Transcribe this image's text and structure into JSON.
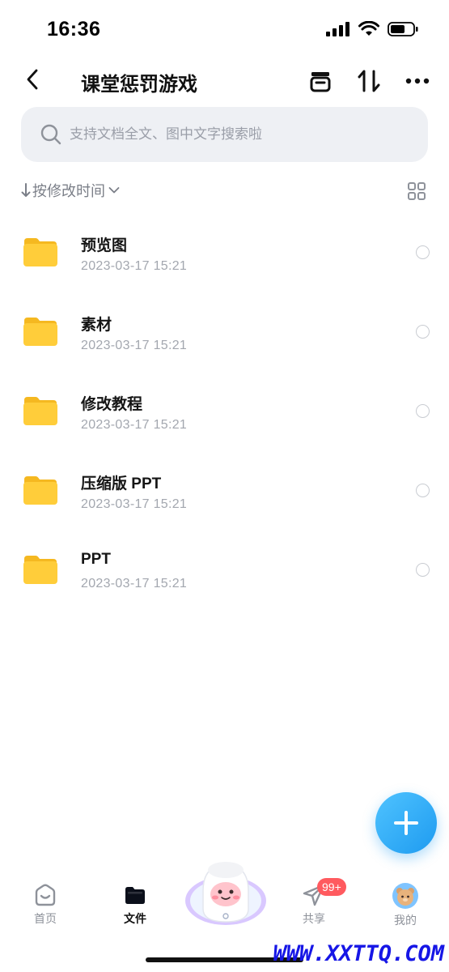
{
  "status_bar": {
    "time": "16:36"
  },
  "header": {
    "title": "课堂惩罚游戏"
  },
  "search": {
    "placeholder": "支持文档全文、图中文字搜索啦"
  },
  "sort": {
    "label": "按修改时间"
  },
  "files": [
    {
      "name": "预览图",
      "date": "2023-03-17 15:21"
    },
    {
      "name": "素材",
      "date": "2023-03-17 15:21"
    },
    {
      "name": "修改教程",
      "date": "2023-03-17 15:21"
    },
    {
      "name": "压缩版 PPT",
      "date": "2023-03-17 15:21"
    },
    {
      "name": "PPT",
      "date": "2023-03-17 15:21"
    }
  ],
  "tabs": {
    "home": "首页",
    "files": "文件",
    "share": "共享",
    "share_badge": "99+",
    "mine": "我的"
  },
  "watermark": "WWW.XXTTQ.COM",
  "colors": {
    "accent": "#1e9bf0",
    "folder": "#ffcd3a",
    "badge": "#ff5a5f"
  }
}
